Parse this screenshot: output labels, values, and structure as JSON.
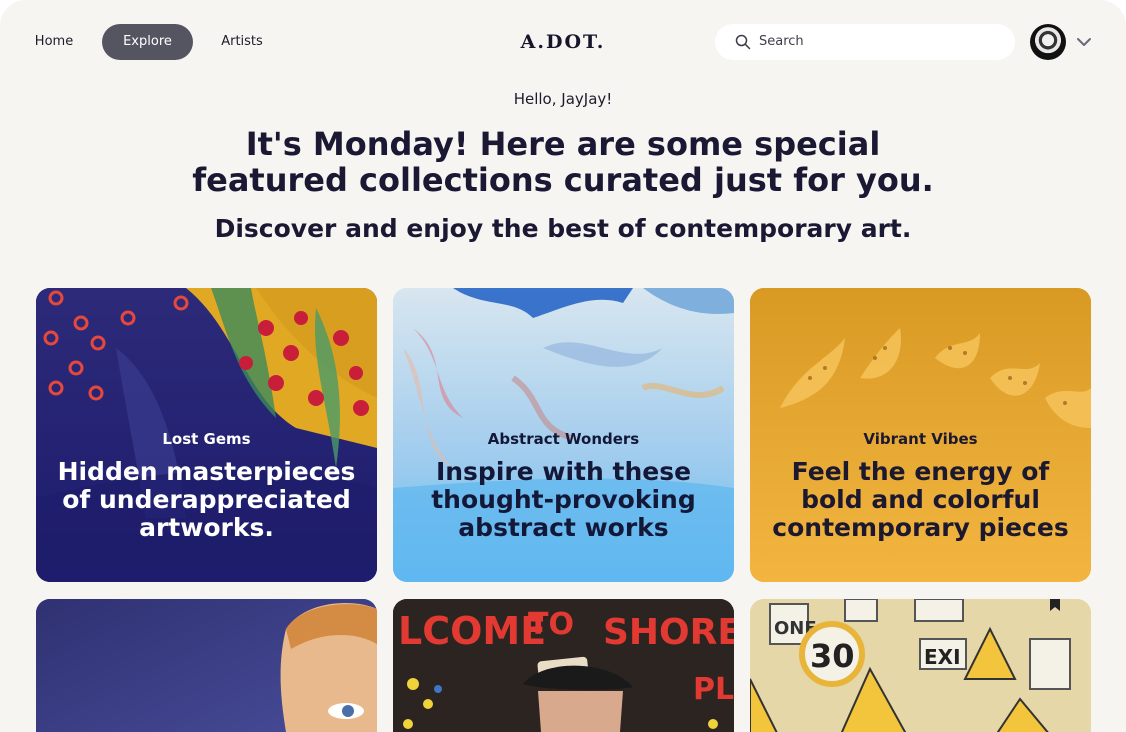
{
  "nav": {
    "home_label": "Home",
    "explore_label": "Explore",
    "artists_label": "Artists",
    "logo_text": "A.DOT.",
    "search_placeholder": "Search"
  },
  "hero": {
    "greeting": "Hello, JayJay!",
    "headline": "It's Monday! Here are some special featured collections curated just for you.",
    "subline": "Discover and enjoy the best of contemporary art."
  },
  "collections": [
    {
      "kicker": "Lost Gems",
      "title": "Hidden masterpieces of underappreciated artworks."
    },
    {
      "kicker": "Abstract Wonders",
      "title": "Inspire with these thought-provoking abstract works"
    },
    {
      "kicker": "Vibrant Vibes",
      "title": "Feel the energy of bold and colorful contemporary pieces"
    }
  ],
  "colors": {
    "background": "#f7f5f2",
    "nav_active": "#555461",
    "heading": "#1a1833"
  },
  "icons": [
    "search-icon",
    "chevron-down-icon"
  ]
}
